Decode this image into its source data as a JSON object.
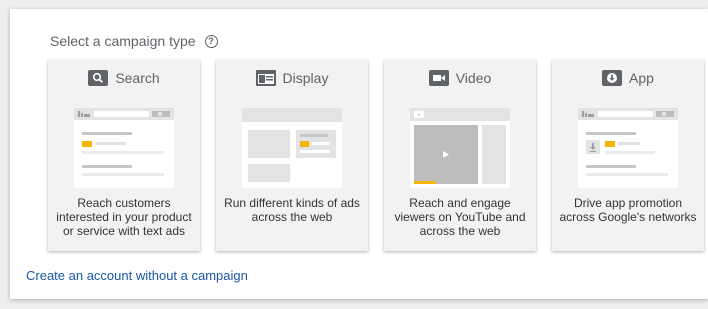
{
  "heading": "Select a campaign type",
  "help_icon": "help-circle-icon",
  "cards": [
    {
      "title": "Search",
      "icon": "search-icon",
      "description": "Reach customers interested in your product or service with text ads"
    },
    {
      "title": "Display",
      "icon": "display-icon",
      "description": "Run different kinds of ads across the web"
    },
    {
      "title": "Video",
      "icon": "video-camera-icon",
      "description": "Reach and engage viewers on YouTube and across the web"
    },
    {
      "title": "App",
      "icon": "app-download-icon",
      "description": "Drive app promotion across Google's networks"
    }
  ],
  "link_text": "Create an account without a campaign",
  "colors": {
    "accent_yellow": "#f4b400",
    "link_blue": "#1a56a8",
    "icon_dark": "#5f6368",
    "placeholder_grey": "#d8d8d8"
  }
}
